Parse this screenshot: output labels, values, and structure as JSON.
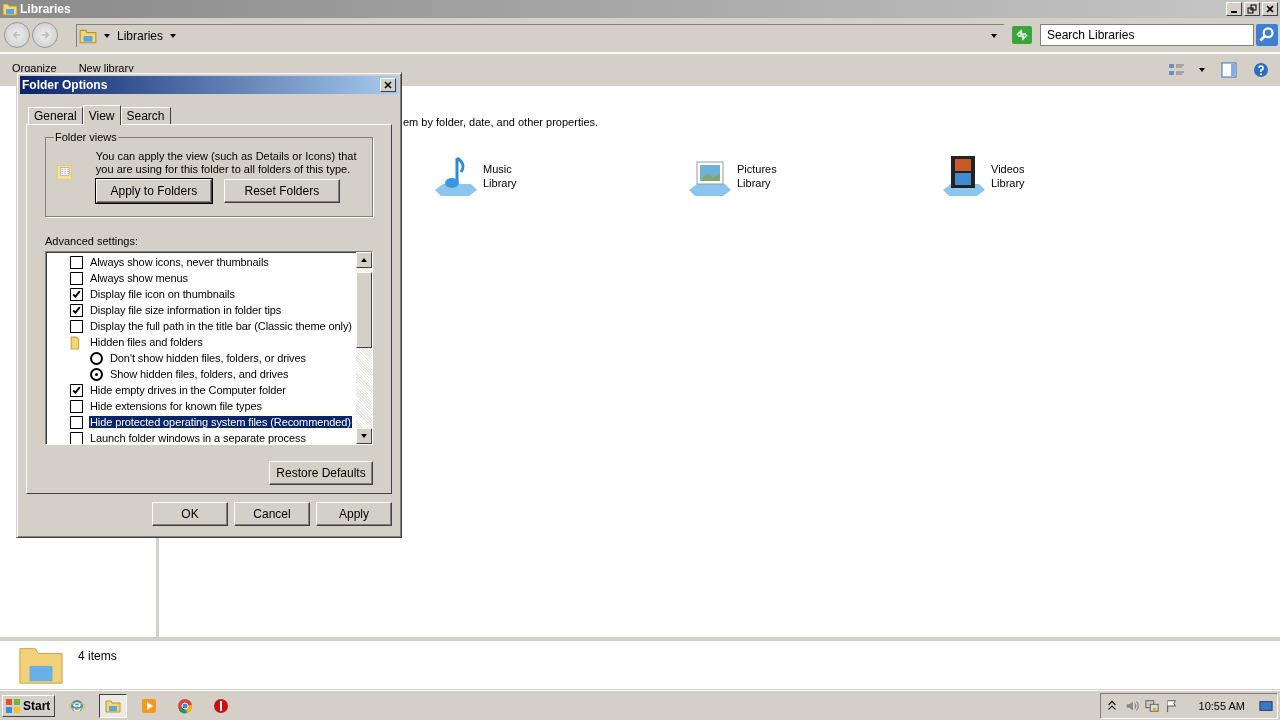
{
  "window": {
    "title": "Libraries"
  },
  "address": {
    "crumb": "Libraries",
    "search_placeholder": "Search Libraries"
  },
  "toolbar": {
    "items": [
      "Organize",
      "New library"
    ]
  },
  "content": {
    "description": "em by folder, date, and other properties.",
    "libraries": [
      {
        "kind": "music",
        "name": "Music",
        "sub": "Library"
      },
      {
        "kind": "pictures",
        "name": "Pictures",
        "sub": "Library"
      },
      {
        "kind": "videos",
        "name": "Videos",
        "sub": "Library"
      }
    ]
  },
  "status": {
    "count": "4 items"
  },
  "dialog": {
    "title": "Folder Options",
    "tabs": [
      {
        "label": "General",
        "selected": false
      },
      {
        "label": "View",
        "selected": true
      },
      {
        "label": "Search",
        "selected": false
      }
    ],
    "folder_views": {
      "legend": "Folder views",
      "text": "You can apply the view (such as Details or Icons) that you are using for this folder to all folders of this type.",
      "buttons": [
        "Apply to Folders",
        "Reset Folders"
      ]
    },
    "advanced_label": "Advanced settings:",
    "settings": [
      {
        "kind": "checkbox",
        "label": "Always show icons, never thumbnails",
        "checked": false,
        "selected": false
      },
      {
        "kind": "checkbox",
        "label": "Always show menus",
        "checked": false,
        "selected": false
      },
      {
        "kind": "checkbox",
        "label": "Display file icon on thumbnails",
        "checked": true,
        "selected": false
      },
      {
        "kind": "checkbox",
        "label": "Display file size information in folder tips",
        "checked": true,
        "selected": false
      },
      {
        "kind": "checkbox",
        "label": "Display the full path in the title bar (Classic theme only)",
        "checked": false,
        "selected": false
      },
      {
        "kind": "folder",
        "label": "Hidden files and folders",
        "selected": false
      },
      {
        "kind": "radio",
        "label": "Don't show hidden files, folders, or drives",
        "checked": false,
        "selected": false
      },
      {
        "kind": "radio",
        "label": "Show hidden files, folders, and drives",
        "checked": true,
        "selected": false
      },
      {
        "kind": "checkbox",
        "label": "Hide empty drives in the Computer folder",
        "checked": true,
        "selected": false
      },
      {
        "kind": "checkbox",
        "label": "Hide extensions for known file types",
        "checked": false,
        "selected": false
      },
      {
        "kind": "checkbox",
        "label": "Hide protected operating system files (Recommended)",
        "checked": false,
        "selected": true
      },
      {
        "kind": "checkbox",
        "label": "Launch folder windows in a separate process",
        "checked": false,
        "selected": false
      }
    ],
    "restore": "Restore Defaults",
    "buttons": [
      "OK",
      "Cancel",
      "Apply"
    ]
  },
  "taskbar": {
    "start": "Start",
    "clock": "10:55 AM",
    "apps": [
      {
        "kind": "ie",
        "selected": false
      },
      {
        "kind": "explorer",
        "selected": true
      },
      {
        "kind": "media",
        "selected": false
      },
      {
        "kind": "chrome",
        "selected": false
      },
      {
        "kind": "stop",
        "selected": false
      }
    ]
  }
}
